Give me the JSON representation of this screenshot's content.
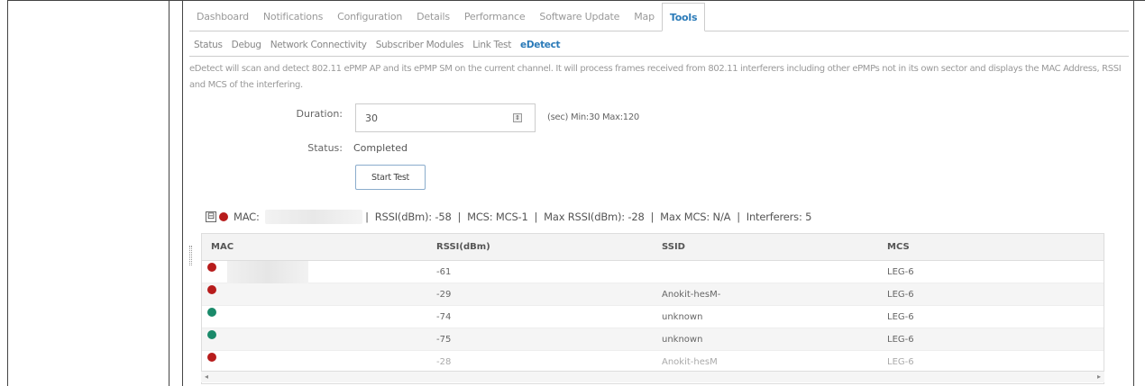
{
  "tabs_primary": [
    {
      "label": "Dashboard",
      "active": false
    },
    {
      "label": "Notifications",
      "active": false
    },
    {
      "label": "Configuration",
      "active": false
    },
    {
      "label": "Details",
      "active": false
    },
    {
      "label": "Performance",
      "active": false
    },
    {
      "label": "Software Update",
      "active": false
    },
    {
      "label": "Map",
      "active": false
    },
    {
      "label": "Tools",
      "active": true
    }
  ],
  "tabs_secondary": [
    {
      "label": "Status",
      "active": false
    },
    {
      "label": "Debug",
      "active": false
    },
    {
      "label": "Network Connectivity",
      "active": false
    },
    {
      "label": "Subscriber Modules",
      "active": false
    },
    {
      "label": "Link Test",
      "active": false
    },
    {
      "label": "eDetect",
      "active": true
    }
  ],
  "description": "eDetect will scan and detect 802.11 ePMP AP and its ePMP SM on the current channel. It will process frames received from 802.11 interferers including other ePMPs not in its own sector and displays the MAC Address, RSSI and MCS of the interfering.",
  "form": {
    "duration_label": "Duration:",
    "duration_value": "30",
    "duration_hint": "(sec) Min:30 Max:120",
    "status_label": "Status:",
    "status_value": "Completed",
    "start_button": "Start Test"
  },
  "summary": {
    "collapse_symbol": "⊟",
    "mac_label": "MAC:",
    "sep1": " |  ",
    "rssi": "RSSI(dBm): -58",
    "sep2": "  |  ",
    "mcs": "MCS: MCS-1",
    "sep3": "  |  ",
    "max_rssi": "Max RSSI(dBm): -28",
    "sep4": "  |  ",
    "max_mcs": "Max MCS: N/A",
    "sep5": "  |  ",
    "interferers": "Interferers: 5",
    "status_color": "#b71c1c"
  },
  "grid": {
    "columns": [
      "MAC",
      "RSSI(dBm)",
      "SSID",
      "MCS"
    ],
    "rows": [
      {
        "status": "red",
        "rssi": "-61",
        "ssid": "",
        "mcs": "LEG-6"
      },
      {
        "status": "red",
        "rssi": "-29",
        "ssid": "Anokit-hesM-",
        "mcs": "LEG-6"
      },
      {
        "status": "green",
        "rssi": "-74",
        "ssid": "unknown",
        "mcs": "LEG-6"
      },
      {
        "status": "green",
        "rssi": "-75",
        "ssid": "unknown",
        "mcs": "LEG-6"
      },
      {
        "status": "red",
        "rssi": "-28",
        "ssid": "Anokit-hesM",
        "mcs": "LEG-6"
      }
    ]
  },
  "colors": {
    "accent": "#2a7ab8",
    "red": "#b71c1c",
    "green": "#1a8a6a"
  }
}
